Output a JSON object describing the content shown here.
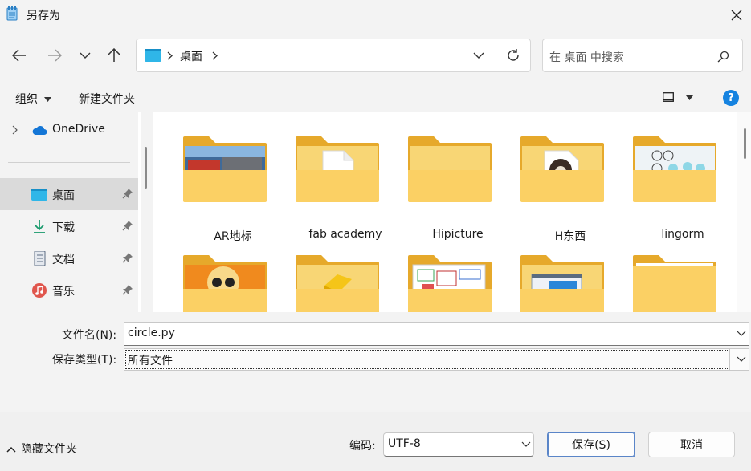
{
  "window": {
    "title": "另存为"
  },
  "nav": {
    "breadcrumb": "桌面",
    "search_placeholder": "在 桌面 中搜索"
  },
  "toolbar": {
    "organize": "组织",
    "new_folder": "新建文件夹"
  },
  "sidebar": {
    "items": [
      {
        "label": "OneDrive",
        "icon": "cloud-icon"
      },
      {
        "label": "桌面",
        "icon": "desktop-icon",
        "pinned": true,
        "selected": true
      },
      {
        "label": "下载",
        "icon": "download-icon",
        "pinned": true
      },
      {
        "label": "文档",
        "icon": "document-icon",
        "pinned": true
      },
      {
        "label": "音乐",
        "icon": "music-icon",
        "pinned": true
      }
    ]
  },
  "folders": [
    {
      "name": "AR地标",
      "preview": "photo"
    },
    {
      "name": "fab academy",
      "preview": "document"
    },
    {
      "name": "Hipicture",
      "preview": "none"
    },
    {
      "name": "H东西",
      "preview": "round-logo"
    },
    {
      "name": "lingorm",
      "preview": "sketch"
    },
    {
      "name": "",
      "preview": "cartoon"
    },
    {
      "name": "",
      "preview": "cube"
    },
    {
      "name": "",
      "preview": "floorplan"
    },
    {
      "name": "",
      "preview": "window"
    },
    {
      "name": "",
      "preview": "none"
    }
  ],
  "form": {
    "filename_label": "文件名(N):",
    "filename_value": "circle.py",
    "filetype_label": "保存类型(T):",
    "filetype_value": "所有文件"
  },
  "footer": {
    "hide_folders": "隐藏文件夹",
    "encoding_label": "编码:",
    "encoding_value": "UTF-8",
    "save": "保存(S)",
    "cancel": "取消"
  },
  "colors": {
    "folder": "#f8c94a",
    "accent": "#0067c0",
    "selected": "#dadada"
  }
}
